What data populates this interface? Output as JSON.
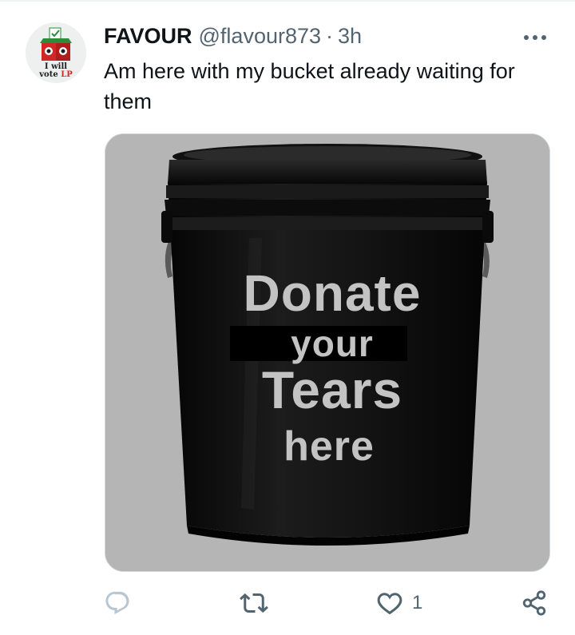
{
  "tweet": {
    "author": {
      "display_name": "FAVOUR",
      "handle": "@flavour873",
      "avatar_text_line1": "I will",
      "avatar_text_line2_prefix": "vote ",
      "avatar_text_line2_accent": "LP"
    },
    "separator": "·",
    "timestamp": "3h",
    "text": "Am here with my bucket already waiting for them",
    "media": {
      "image_text": {
        "line1": "Donate",
        "line2": "your",
        "line3": "Tears",
        "line4": "here"
      }
    },
    "actions": {
      "reply_count": "",
      "retweet_count": "",
      "like_count": "1"
    }
  },
  "icons": {
    "more": "more-horizontal-icon",
    "reply": "reply-bubble-icon",
    "retweet": "retweet-arrows-icon",
    "like": "heart-icon",
    "share": "share-nodes-icon"
  },
  "colors": {
    "text_primary": "#0f1419",
    "text_secondary": "#536471",
    "border": "#cfd9de",
    "avatar_accent": "#d22727",
    "avatar_green": "#2e8b3a"
  }
}
